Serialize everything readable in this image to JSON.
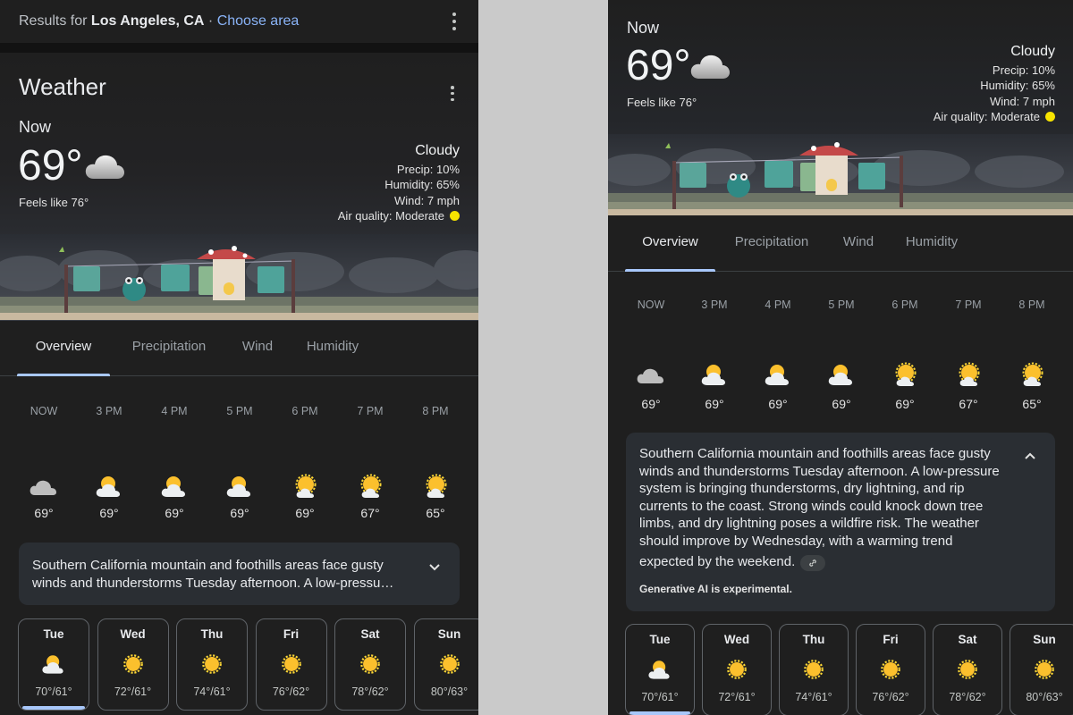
{
  "results": {
    "prefix": "Results for",
    "location": "Los Angeles, CA",
    "separator": "·",
    "choose_area": "Choose area"
  },
  "weather": {
    "title": "Weather",
    "now_label": "Now",
    "temperature": "69°",
    "feels_like": "Feels like 76°",
    "condition": "Cloudy",
    "precip": "Precip: 10%",
    "humidity": "Humidity: 65%",
    "wind": "Wind: 7 mph",
    "air_quality": "Air quality: Moderate",
    "air_quality_color": "#f7e400"
  },
  "tabs": [
    {
      "label": "Overview",
      "active": true
    },
    {
      "label": "Precipitation",
      "active": false
    },
    {
      "label": "Wind",
      "active": false
    },
    {
      "label": "Humidity",
      "active": false
    }
  ],
  "hourly": [
    {
      "time": "NOW",
      "temp": "69°",
      "icon": "cloudy-icon"
    },
    {
      "time": "3 PM",
      "temp": "69°",
      "icon": "partly-cloudy-icon"
    },
    {
      "time": "4 PM",
      "temp": "69°",
      "icon": "partly-cloudy-icon"
    },
    {
      "time": "5 PM",
      "temp": "69°",
      "icon": "partly-cloudy-icon"
    },
    {
      "time": "6 PM",
      "temp": "69°",
      "icon": "mostly-sunny-icon"
    },
    {
      "time": "7 PM",
      "temp": "67°",
      "icon": "mostly-sunny-icon"
    },
    {
      "time": "8 PM",
      "temp": "65°",
      "icon": "mostly-sunny-icon"
    }
  ],
  "summary": {
    "collapsed_line1": "Southern California mountain and foothills areas face gusty",
    "collapsed_line2": "winds and thunderstorms Tuesday afternoon. A low-pressu…",
    "expanded_lines": [
      "Southern California mountain and foothills areas face gusty",
      "winds and thunderstorms Tuesday afternoon. A low-pressure",
      "system is bringing thunderstorms, dry lightning, and rip",
      "currents to the coast. Strong winds could knock down tree",
      "limbs, and dry lightning poses a wildfire risk. The weather",
      "should improve by Wednesday, with a warming trend",
      "expected by the weekend."
    ],
    "ai_note": "Generative AI is experimental."
  },
  "daily": [
    {
      "day": "Tue",
      "range": "70°/61°",
      "icon": "partly-cloudy-icon",
      "selected": true
    },
    {
      "day": "Wed",
      "range": "72°/61°",
      "icon": "sunny-icon",
      "selected": false
    },
    {
      "day": "Thu",
      "range": "74°/61°",
      "icon": "sunny-icon",
      "selected": false
    },
    {
      "day": "Fri",
      "range": "76°/62°",
      "icon": "sunny-icon",
      "selected": false
    },
    {
      "day": "Sat",
      "range": "78°/62°",
      "icon": "sunny-icon",
      "selected": false
    },
    {
      "day": "Sun",
      "range": "80°/63°",
      "icon": "sunny-icon",
      "selected": false
    }
  ]
}
